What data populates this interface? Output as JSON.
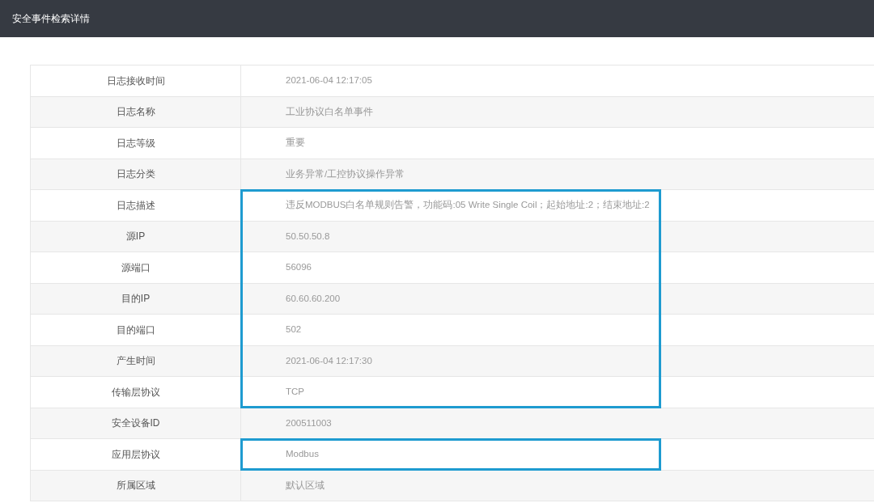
{
  "header": {
    "title": "安全事件检索详情"
  },
  "rows": [
    {
      "label": "日志接收时间",
      "value": "2021-06-04 12:17:05",
      "highlighted": false
    },
    {
      "label": "日志名称",
      "value": "工业协议白名单事件",
      "highlighted": false
    },
    {
      "label": "日志等级",
      "value": "重要",
      "highlighted": false
    },
    {
      "label": "日志分类",
      "value": "业务异常/工控协议操作异常",
      "highlighted": false
    },
    {
      "label": "日志描述",
      "value": "违反MODBUS白名单规则告警，功能码:05 Write Single Coil；起始地址:2；结束地址:2",
      "highlighted": true
    },
    {
      "label": "源IP",
      "value": "50.50.50.8",
      "highlighted": true
    },
    {
      "label": "源端口",
      "value": "56096",
      "highlighted": true
    },
    {
      "label": "目的IP",
      "value": "60.60.60.200",
      "highlighted": true
    },
    {
      "label": "目的端口",
      "value": "502",
      "highlighted": true
    },
    {
      "label": "产生时间",
      "value": "2021-06-04 12:17:30",
      "highlighted": true
    },
    {
      "label": "传输层协议",
      "value": "TCP",
      "highlighted": true
    },
    {
      "label": "安全设备ID",
      "value": "200511003",
      "highlighted": false
    },
    {
      "label": "应用层协议",
      "value": "Modbus",
      "highlighted": true
    },
    {
      "label": "所属区域",
      "value": "默认区域",
      "highlighted": false
    }
  ]
}
